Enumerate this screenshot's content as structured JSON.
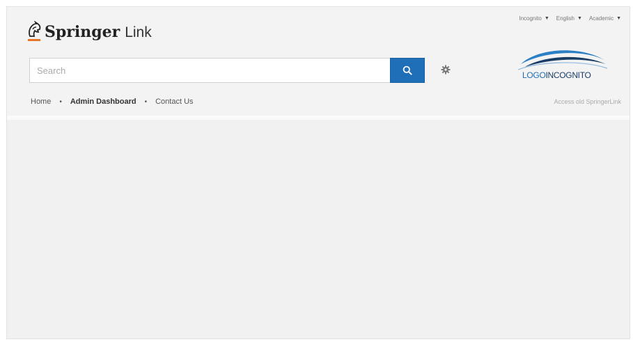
{
  "brand": {
    "name_bold": "Springer",
    "name_light": "Link",
    "accent_color": "#e8742a",
    "primary_color": "#1f6eb8"
  },
  "util_menu": {
    "items": [
      {
        "label": "Incognito",
        "icon": "caret-down-icon"
      },
      {
        "label": "English",
        "icon": "caret-down-icon"
      },
      {
        "label": "Academic",
        "icon": "caret-down-icon"
      }
    ]
  },
  "search": {
    "placeholder": "Search",
    "value": "",
    "button_icon": "search-icon",
    "settings_icon": "gear-icon"
  },
  "nav": {
    "items": [
      {
        "label": "Home",
        "active": false
      },
      {
        "label": "Admin Dashboard",
        "active": true
      },
      {
        "label": "Contact Us",
        "active": false
      }
    ],
    "separator": "•"
  },
  "institution_logo": {
    "part1": "LOGO",
    "part2": "INCOGNITO"
  },
  "old_site_link": "Access old SpringerLink"
}
